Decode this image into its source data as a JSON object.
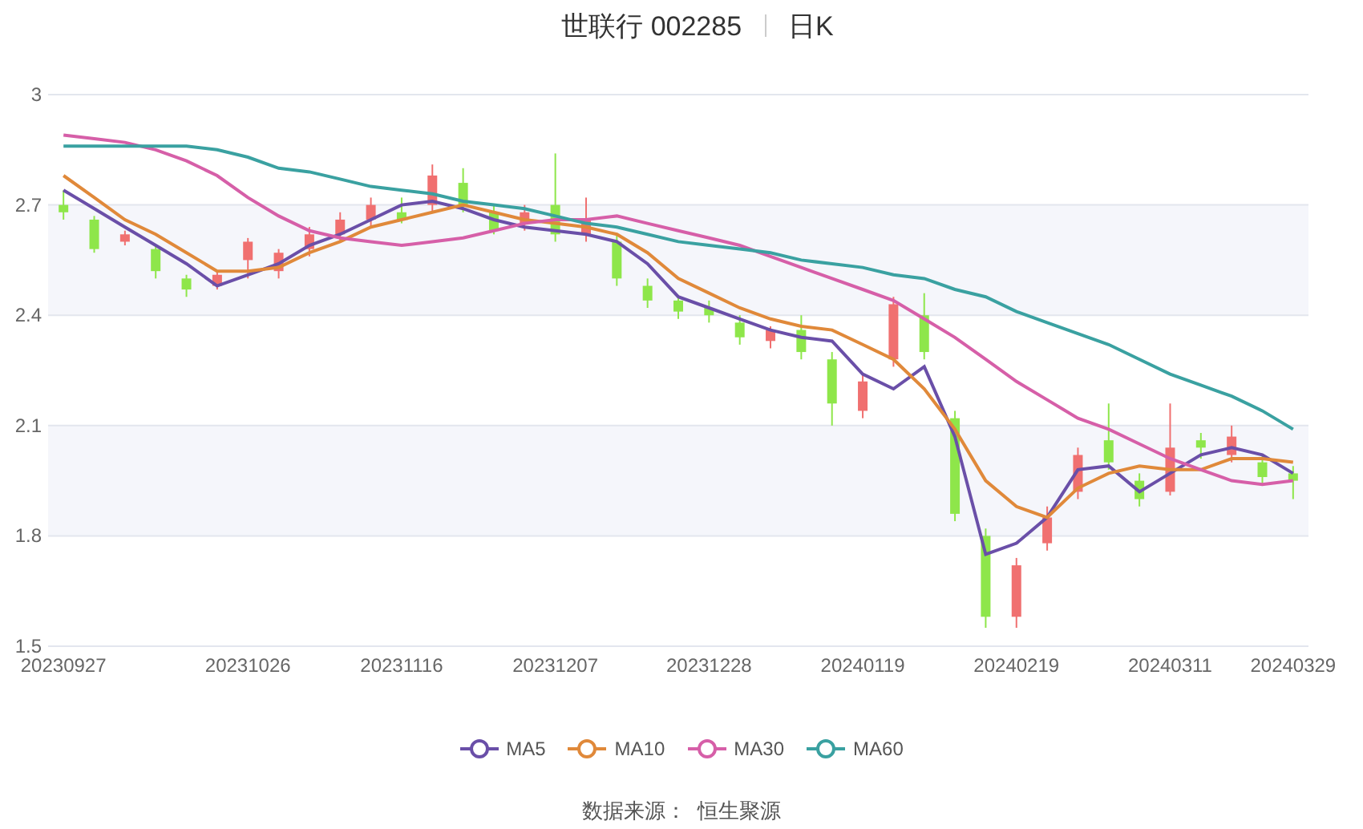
{
  "title": {
    "name": "世联行 002285",
    "period": "日K"
  },
  "chart": {
    "chart_data": {
      "type": "candlestick",
      "grid": true,
      "ylim": [
        1.5,
        3
      ],
      "yticks": [
        {
          "value": 1.5,
          "label": "1.5"
        },
        {
          "value": 1.8,
          "label": "1.8"
        },
        {
          "value": 2.1,
          "label": "2.1"
        },
        {
          "value": 2.4,
          "label": "2.4"
        },
        {
          "value": 2.7,
          "label": "2.7"
        },
        {
          "value": 3,
          "label": "3"
        }
      ],
      "categories": [
        "20230927",
        null,
        null,
        null,
        null,
        null,
        "20231026",
        null,
        null,
        null,
        null,
        "20231116",
        null,
        null,
        null,
        null,
        "20231207",
        null,
        null,
        null,
        null,
        "20231228",
        null,
        null,
        null,
        null,
        "20240119",
        null,
        null,
        null,
        null,
        "20240219",
        null,
        null,
        null,
        null,
        "20240311",
        null,
        null,
        null,
        "20240329"
      ],
      "ohlc": [
        [
          2.7,
          2.74,
          2.66,
          2.68
        ],
        [
          2.66,
          2.67,
          2.57,
          2.58
        ],
        [
          2.6,
          2.63,
          2.59,
          2.62
        ],
        [
          2.58,
          2.59,
          2.5,
          2.52
        ],
        [
          2.5,
          2.51,
          2.45,
          2.47
        ],
        [
          2.48,
          2.52,
          2.47,
          2.51
        ],
        [
          2.55,
          2.61,
          2.5,
          2.6
        ],
        [
          2.52,
          2.58,
          2.5,
          2.57
        ],
        [
          2.58,
          2.64,
          2.56,
          2.62
        ],
        [
          2.62,
          2.68,
          2.6,
          2.66
        ],
        [
          2.66,
          2.72,
          2.64,
          2.7
        ],
        [
          2.68,
          2.72,
          2.65,
          2.66
        ],
        [
          2.7,
          2.81,
          2.68,
          2.78
        ],
        [
          2.76,
          2.8,
          2.68,
          2.7
        ],
        [
          2.68,
          2.7,
          2.62,
          2.63
        ],
        [
          2.65,
          2.7,
          2.63,
          2.68
        ],
        [
          2.7,
          2.84,
          2.6,
          2.62
        ],
        [
          2.62,
          2.72,
          2.6,
          2.66
        ],
        [
          2.6,
          2.62,
          2.48,
          2.5
        ],
        [
          2.48,
          2.5,
          2.42,
          2.44
        ],
        [
          2.44,
          2.45,
          2.39,
          2.41
        ],
        [
          2.42,
          2.44,
          2.38,
          2.4
        ],
        [
          2.38,
          2.4,
          2.32,
          2.34
        ],
        [
          2.33,
          2.37,
          2.31,
          2.36
        ],
        [
          2.36,
          2.4,
          2.28,
          2.3
        ],
        [
          2.28,
          2.3,
          2.1,
          2.16
        ],
        [
          2.14,
          2.24,
          2.12,
          2.22
        ],
        [
          2.28,
          2.45,
          2.26,
          2.43
        ],
        [
          2.4,
          2.46,
          2.28,
          2.3
        ],
        [
          2.12,
          2.14,
          1.84,
          1.86
        ],
        [
          1.8,
          1.82,
          1.55,
          1.58
        ],
        [
          1.58,
          1.74,
          1.55,
          1.72
        ],
        [
          1.78,
          1.88,
          1.76,
          1.85
        ],
        [
          1.92,
          2.04,
          1.9,
          2.02
        ],
        [
          2.06,
          2.16,
          1.98,
          2.0
        ],
        [
          1.95,
          1.97,
          1.88,
          1.9
        ],
        [
          1.92,
          2.16,
          1.91,
          2.04
        ],
        [
          2.06,
          2.08,
          2.01,
          2.04
        ],
        [
          2.02,
          2.1,
          2.0,
          2.07
        ],
        [
          2.0,
          2.02,
          1.94,
          1.96
        ],
        [
          1.97,
          1.99,
          1.9,
          1.95
        ]
      ],
      "series": [
        {
          "name": "MA5",
          "type": "line",
          "color": "#6a4fa8",
          "values": [
            2.74,
            2.69,
            2.64,
            2.59,
            2.54,
            2.48,
            2.51,
            2.54,
            2.59,
            2.62,
            2.66,
            2.7,
            2.71,
            2.69,
            2.66,
            2.64,
            2.63,
            2.62,
            2.6,
            2.54,
            2.45,
            2.42,
            2.39,
            2.36,
            2.34,
            2.33,
            2.24,
            2.2,
            2.26,
            2.07,
            1.75,
            1.78,
            1.85,
            1.98,
            1.99,
            1.92,
            1.97,
            2.02,
            2.04,
            2.02,
            1.97
          ]
        },
        {
          "name": "MA10",
          "type": "line",
          "color": "#e0893a",
          "values": [
            2.78,
            2.72,
            2.66,
            2.62,
            2.57,
            2.52,
            2.52,
            2.53,
            2.57,
            2.6,
            2.64,
            2.66,
            2.68,
            2.7,
            2.68,
            2.66,
            2.65,
            2.64,
            2.62,
            2.57,
            2.5,
            2.46,
            2.42,
            2.39,
            2.37,
            2.36,
            2.32,
            2.28,
            2.2,
            2.09,
            1.95,
            1.88,
            1.85,
            1.93,
            1.97,
            1.99,
            1.98,
            1.98,
            2.01,
            2.01,
            2.0
          ]
        },
        {
          "name": "MA30",
          "type": "line",
          "color": "#d65fa8",
          "values": [
            2.89,
            2.88,
            2.87,
            2.85,
            2.82,
            2.78,
            2.72,
            2.67,
            2.63,
            2.61,
            2.6,
            2.59,
            2.6,
            2.61,
            2.63,
            2.65,
            2.66,
            2.66,
            2.67,
            2.65,
            2.63,
            2.61,
            2.59,
            2.56,
            2.53,
            2.5,
            2.47,
            2.44,
            2.39,
            2.34,
            2.28,
            2.22,
            2.17,
            2.12,
            2.09,
            2.05,
            2.01,
            1.98,
            1.95,
            1.94,
            1.95
          ]
        },
        {
          "name": "MA60",
          "type": "line",
          "color": "#3aa1a1",
          "values": [
            2.86,
            2.86,
            2.86,
            2.86,
            2.86,
            2.85,
            2.83,
            2.8,
            2.79,
            2.77,
            2.75,
            2.74,
            2.73,
            2.71,
            2.7,
            2.69,
            2.67,
            2.65,
            2.64,
            2.62,
            2.6,
            2.59,
            2.58,
            2.57,
            2.55,
            2.54,
            2.53,
            2.51,
            2.5,
            2.47,
            2.45,
            2.41,
            2.38,
            2.35,
            2.32,
            2.28,
            2.24,
            2.21,
            2.18,
            2.14,
            2.09
          ]
        }
      ]
    }
  },
  "source": "数据来源：  恒生聚源"
}
